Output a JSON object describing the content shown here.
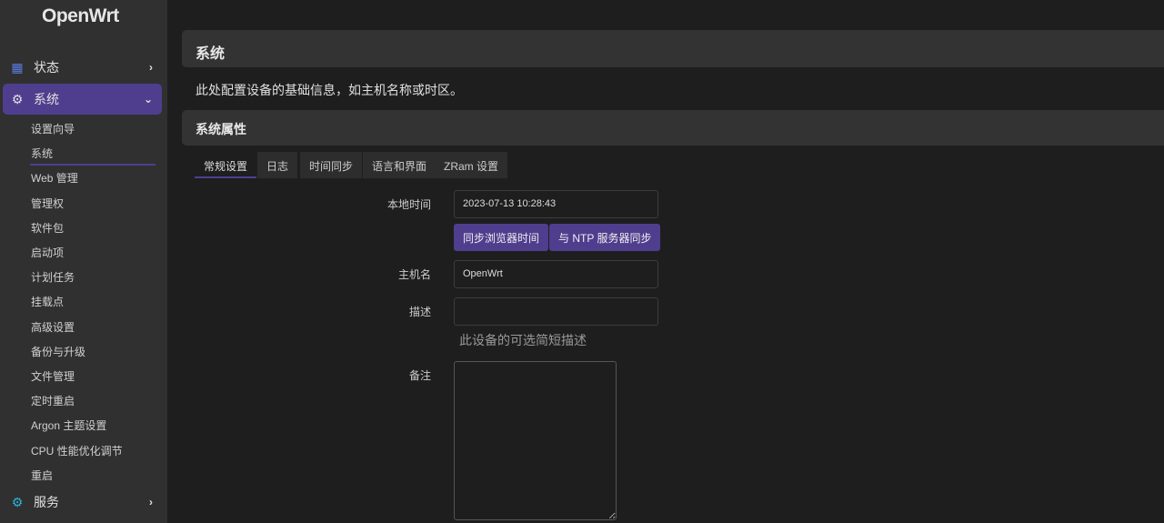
{
  "brand": "OpenWrt",
  "sidebar": {
    "status": "状态",
    "system": "系统",
    "services": "服务",
    "sub": [
      "设置向导",
      "系统",
      "Web 管理",
      "管理权",
      "软件包",
      "启动项",
      "计划任务",
      "挂载点",
      "高级设置",
      "备份与升级",
      "文件管理",
      "定时重启",
      "Argon 主题设置",
      "CPU 性能优化调节",
      "重启"
    ]
  },
  "page": {
    "title": "系统",
    "description": "此处配置设备的基础信息，如主机名称或时区。",
    "section": "系统属性"
  },
  "tabs": [
    "常规设置",
    "日志",
    "时间同步",
    "语言和界面",
    "ZRam 设置"
  ],
  "form": {
    "local_time_label": "本地时间",
    "local_time": "2023-07-13 10:28:43",
    "sync_browser": "同步浏览器时间",
    "sync_ntp": "与 NTP 服务器同步",
    "hostname_label": "主机名",
    "hostname": "OpenWrt",
    "description_label": "描述",
    "description": "",
    "description_hint": "此设备的可选简短描述",
    "notes_label": "备注"
  }
}
